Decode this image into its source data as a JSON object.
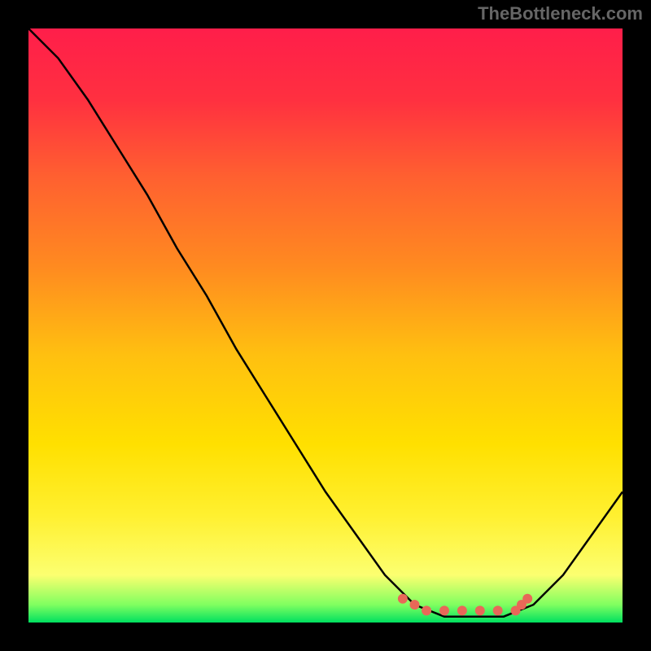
{
  "watermark": "TheBottleneck.com",
  "chart_data": {
    "type": "line",
    "title": "",
    "xlabel": "",
    "ylabel": "",
    "xlim": [
      0,
      100
    ],
    "ylim": [
      0,
      100
    ],
    "background": {
      "type": "vertical-gradient",
      "stops": [
        {
          "pos": 0,
          "color": "#ff1e4a"
        },
        {
          "pos": 12,
          "color": "#ff3040"
        },
        {
          "pos": 25,
          "color": "#ff6030"
        },
        {
          "pos": 40,
          "color": "#ff8a20"
        },
        {
          "pos": 55,
          "color": "#ffc010"
        },
        {
          "pos": 70,
          "color": "#ffe000"
        },
        {
          "pos": 82,
          "color": "#fff030"
        },
        {
          "pos": 92,
          "color": "#fcff70"
        },
        {
          "pos": 97,
          "color": "#80ff60"
        },
        {
          "pos": 100,
          "color": "#00e060"
        }
      ]
    },
    "series": [
      {
        "name": "bottleneck-curve",
        "color": "#000000",
        "points": [
          {
            "x": 0,
            "y": 100
          },
          {
            "x": 5,
            "y": 95
          },
          {
            "x": 10,
            "y": 88
          },
          {
            "x": 15,
            "y": 80
          },
          {
            "x": 20,
            "y": 72
          },
          {
            "x": 25,
            "y": 63
          },
          {
            "x": 30,
            "y": 55
          },
          {
            "x": 35,
            "y": 46
          },
          {
            "x": 40,
            "y": 38
          },
          {
            "x": 45,
            "y": 30
          },
          {
            "x": 50,
            "y": 22
          },
          {
            "x": 55,
            "y": 15
          },
          {
            "x": 60,
            "y": 8
          },
          {
            "x": 65,
            "y": 3
          },
          {
            "x": 70,
            "y": 1
          },
          {
            "x": 75,
            "y": 1
          },
          {
            "x": 80,
            "y": 1
          },
          {
            "x": 85,
            "y": 3
          },
          {
            "x": 90,
            "y": 8
          },
          {
            "x": 95,
            "y": 15
          },
          {
            "x": 100,
            "y": 22
          }
        ]
      },
      {
        "name": "optimal-zone-markers",
        "color": "#e86858",
        "type": "scatter",
        "points": [
          {
            "x": 63,
            "y": 4
          },
          {
            "x": 65,
            "y": 3
          },
          {
            "x": 67,
            "y": 2
          },
          {
            "x": 70,
            "y": 2
          },
          {
            "x": 73,
            "y": 2
          },
          {
            "x": 76,
            "y": 2
          },
          {
            "x": 79,
            "y": 2
          },
          {
            "x": 82,
            "y": 2
          },
          {
            "x": 83,
            "y": 3
          },
          {
            "x": 84,
            "y": 4
          }
        ]
      }
    ]
  }
}
